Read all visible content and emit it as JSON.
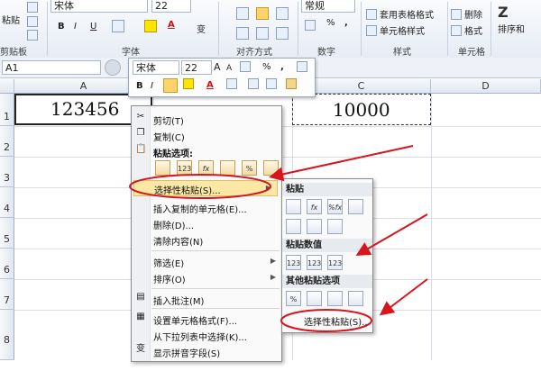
{
  "ribbon": {
    "clipboard": {
      "paste_label": "粘贴",
      "group_label": "剪贴板"
    },
    "font": {
      "name": "宋体",
      "size": "22",
      "bold": "B",
      "italic": "I",
      "underline": "U",
      "phonetic": "变",
      "font_color_letter": "A",
      "group_label": "字体"
    },
    "align": {
      "group_label": "对齐方式"
    },
    "number": {
      "format": "常规",
      "percent": "%",
      "comma": ",",
      "group_label": "数字"
    },
    "styles": {
      "table_format": "套用表格格式",
      "cell_styles": "单元格样式",
      "group_label": "样式"
    },
    "cells": {
      "delete": "删除",
      "format": "格式",
      "group_label": "单元格"
    },
    "editing": {
      "sort_filter": "排序和"
    }
  },
  "formula_bar": {
    "name_box": "A1"
  },
  "mini_toolbar": {
    "font": "宋体",
    "size": "22",
    "grow": "A",
    "shrink": "A",
    "percent": "%",
    "comma": ",",
    "bold": "B",
    "italic": "I",
    "font_color": "A"
  },
  "columns": [
    "A",
    "B",
    "C",
    "D"
  ],
  "rows": [
    "1",
    "2",
    "3",
    "4",
    "5",
    "6",
    "7",
    "8"
  ],
  "cells": {
    "A1": "123456",
    "C1": "10000"
  },
  "context_menu": {
    "cut": "剪切(T)",
    "copy": "复制(C)",
    "paste_options": "粘贴选项:",
    "paste_buttons": [
      "",
      "123",
      "fx",
      "",
      "%",
      ""
    ],
    "paste_special": "选择性粘贴(S)...",
    "insert_copied": "插入复制的单元格(E)...",
    "delete": "删除(D)...",
    "clear": "清除内容(N)",
    "filter": "筛选(E)",
    "sort": "排序(O)",
    "insert_comment": "插入批注(M)",
    "format_cells": "设置单元格格式(F)...",
    "pick_list": "从下拉列表中选择(K)...",
    "phonetic": "显示拼音字段(S)"
  },
  "submenu": {
    "paste_header": "粘贴",
    "paste_values_header": "粘贴数值",
    "other_header": "其他粘贴选项",
    "paste_special": "选择性粘贴(S)...",
    "value_buttons": [
      "123",
      "123",
      "123"
    ],
    "paste_buttons": [
      "",
      "fx",
      "%fx",
      ""
    ]
  },
  "colors": {
    "annotation_red": "#d8141c",
    "highlight": "#ffe38a"
  }
}
